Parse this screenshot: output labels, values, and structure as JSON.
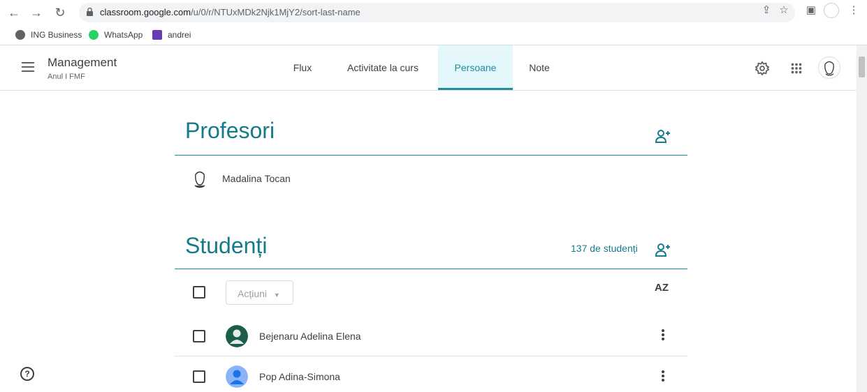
{
  "browser": {
    "url_host": "classroom.google.com",
    "url_path": "/u/0/r/NTUxMDk2Njk1MjY2/sort-last-name",
    "bookmarks": [
      {
        "label": "ING Business",
        "color": "#5f6368"
      },
      {
        "label": "WhatsApp",
        "color": "#25d366"
      },
      {
        "label": "andrei",
        "color": "#673ab7"
      }
    ]
  },
  "header": {
    "class_name": "Management",
    "class_section": "Anul I FMF",
    "tabs": [
      {
        "label": "Flux"
      },
      {
        "label": "Activitate la curs"
      },
      {
        "label": "Persoane"
      },
      {
        "label": "Note"
      }
    ],
    "active_tab": "Persoane"
  },
  "teachers": {
    "title": "Profesori",
    "list": [
      {
        "name": "Madalina Tocan"
      }
    ]
  },
  "students": {
    "title": "Studenți",
    "count_label": "137 de studenți",
    "actions_label": "Acțiuni",
    "sort_icon_label": "AZ",
    "list": [
      {
        "name": "Bejenaru Adelina Elena",
        "avatar_color": "#1b5e4a"
      },
      {
        "name": "Pop Adina-Simona",
        "avatar_color": "#8ab4f8"
      }
    ]
  },
  "colors": {
    "accent": "#1e8e9e",
    "title": "#137b8a",
    "active_tab_bg": "#e4f7fb"
  }
}
